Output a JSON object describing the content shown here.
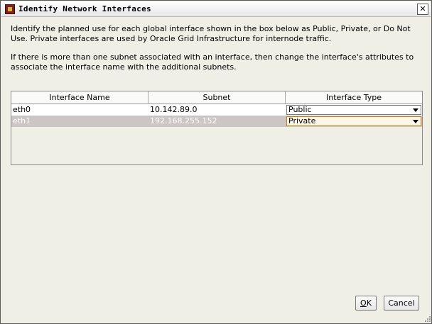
{
  "window": {
    "title": "Identify Network Interfaces",
    "close_glyph": "✕"
  },
  "description": {
    "para1": "Identify the planned use for each global interface shown in the box below as Public, Private, or Do Not Use. Private interfaces are used by Oracle Grid Infrastructure for internode traffic.",
    "para2": "If there is more than one subnet associated with an interface, then change the interface's attributes to associate the interface name with the additional subnets."
  },
  "table": {
    "headers": [
      "Interface Name",
      "Subnet",
      "Interface Type"
    ],
    "rows": [
      {
        "name": "eth0",
        "subnet": "10.142.89.0",
        "type": "Public",
        "selected": false
      },
      {
        "name": "eth1",
        "subnet": "192.168.255.152",
        "type": "Private",
        "selected": true
      }
    ]
  },
  "buttons": {
    "ok_mnemonic": "O",
    "ok_rest": "K",
    "cancel": "Cancel"
  },
  "colors": {
    "selection_row": "#cbc6c3",
    "focus_border": "#c87c1e"
  },
  "icons": {
    "title": "oracle-app-icon",
    "close": "close-icon",
    "dropdown": "chevron-down-icon"
  }
}
